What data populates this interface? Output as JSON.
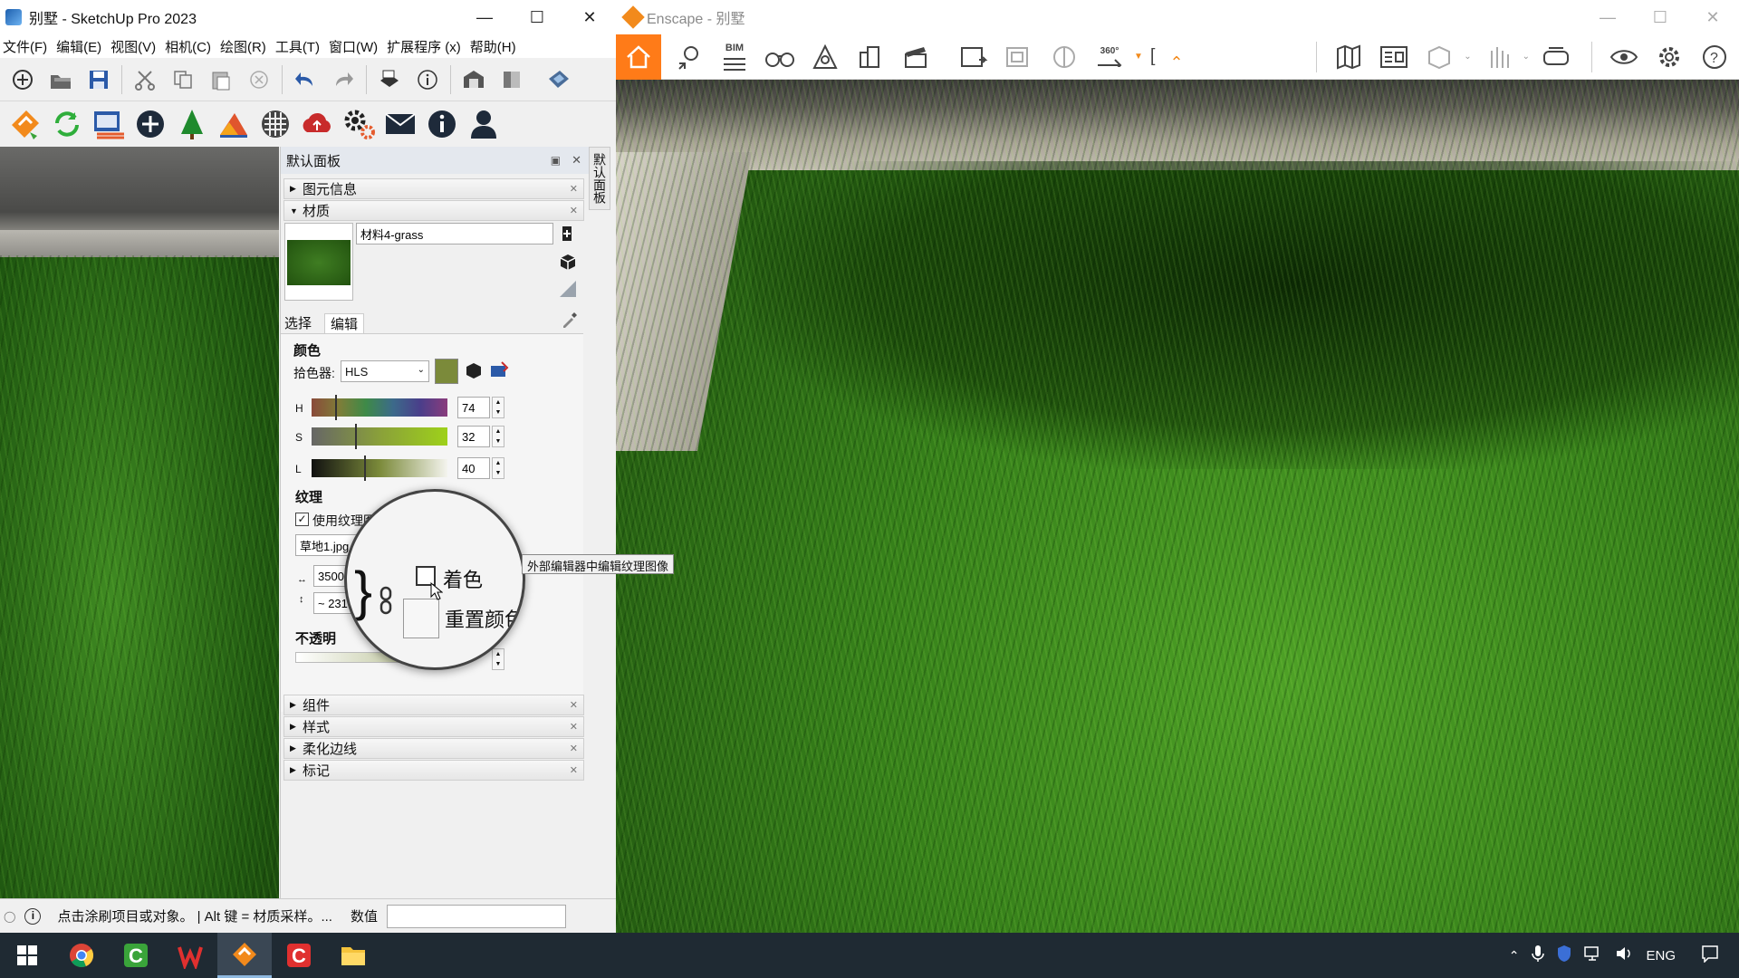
{
  "sketchup": {
    "title": "别墅 - SketchUp Pro 2023",
    "menu": [
      "文件(F)",
      "编辑(E)",
      "视图(V)",
      "相机(C)",
      "绘图(R)",
      "工具(T)",
      "窗口(W)",
      "扩展程序 (x)",
      "帮助(H)"
    ],
    "panel": {
      "title": "默认面板",
      "side_tab": "默认面板",
      "sections_top": [
        "图元信息",
        "材质"
      ],
      "material_name": "材料4-grass",
      "tabs": [
        "选择",
        "编辑"
      ],
      "color_label": "颜色",
      "picker_label": "拾色器:",
      "picker_value": "HLS",
      "swatch_color": "#7b8a3a",
      "h_label": "H",
      "h_value": "74",
      "s_label": "S",
      "s_value": "32",
      "l_label": "L",
      "l_value": "40",
      "texture_label": "纹理",
      "use_texture_label": "使用纹理图",
      "texture_file": "草地1.jpg",
      "width_value": "3500",
      "height_value": "~ 231",
      "opacity_label": "不透明",
      "tooltip": "外部编辑器中编辑纹理图像",
      "magnifier": {
        "colorize_label": "着色",
        "reset_label": "重置颜色"
      },
      "sections_bottom": [
        "组件",
        "样式",
        "柔化边线",
        "标记"
      ]
    },
    "status": {
      "message": "点击涂刷项目或对象。 | Alt 键 = 材质采样。...",
      "value_label": "数值"
    }
  },
  "enscape": {
    "title": "Enscape - 别墅",
    "accent_color": "#ff7b18",
    "bim_label": "BIM",
    "pano_label": "360°"
  },
  "taskbar": {
    "lang": "ENG",
    "icons": [
      "start-icon",
      "chrome-icon",
      "camtasia-icon",
      "wps-icon",
      "enscape-icon",
      "camtasia-recorder-icon",
      "file-explorer-icon"
    ]
  }
}
